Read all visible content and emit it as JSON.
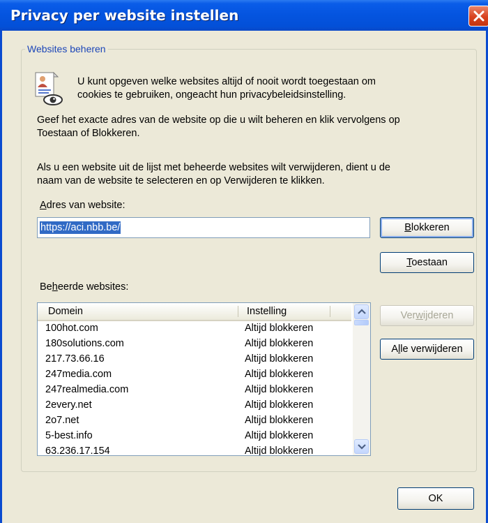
{
  "window": {
    "title": "Privacy per website instellen"
  },
  "group": {
    "legend": "Websites beheren"
  },
  "intro": {
    "line1": "U kunt opgeven welke websites altijd of nooit wordt toegestaan om",
    "line2": "cookies te gebruiken, ongeacht hun privacybeleidsinstelling."
  },
  "instructions": {
    "p1_line1": "Geef het exacte adres van de website op die u wilt beheren en klik vervolgens op",
    "p1_line2": "Toestaan of Blokkeren.",
    "p2_line1": "Als u een website uit de lijst met beheerde websites wilt verwijderen, dient u de",
    "p2_line2": "naam van de website te selecteren en op Verwijderen te klikken."
  },
  "address": {
    "label_prefix": "",
    "label_access": "A",
    "label_rest": "dres van website:",
    "value": "https://aci.nbb.be/"
  },
  "buttons": {
    "block": {
      "access": "B",
      "rest": "lokkeren"
    },
    "allow": {
      "access": "T",
      "rest": "oestaan"
    },
    "remove": {
      "pre": "Ver",
      "access": "w",
      "rest": "ijderen"
    },
    "remove_all": {
      "pre": "A",
      "access": "l",
      "rest": "le verwijderen"
    },
    "ok": "OK"
  },
  "managed": {
    "label_pre": "Be",
    "label_access": "h",
    "label_rest": "eerde websites:",
    "columns": {
      "domain": "Domein",
      "setting": "Instelling"
    },
    "rows": [
      {
        "domain": "100hot.com",
        "setting": "Altijd blokkeren"
      },
      {
        "domain": "180solutions.com",
        "setting": "Altijd blokkeren"
      },
      {
        "domain": "217.73.66.16",
        "setting": "Altijd blokkeren"
      },
      {
        "domain": "247media.com",
        "setting": "Altijd blokkeren"
      },
      {
        "domain": "247realmedia.com",
        "setting": "Altijd blokkeren"
      },
      {
        "domain": "2every.net",
        "setting": "Altijd blokkeren"
      },
      {
        "domain": "2o7.net",
        "setting": "Altijd blokkeren"
      },
      {
        "domain": "5-best.info",
        "setting": "Altijd blokkeren"
      },
      {
        "domain": "63.236.17.154",
        "setting": "Altijd blokkeren"
      }
    ]
  },
  "icons": {
    "intro": "privacy-report-icon",
    "close": "close-icon",
    "up": "scroll-up-icon",
    "down": "scroll-down-icon"
  },
  "colors": {
    "titlebar": "#0454df",
    "legend": "#1c46b8",
    "selection": "#316ac5",
    "dialog_bg": "#ece9d8"
  }
}
